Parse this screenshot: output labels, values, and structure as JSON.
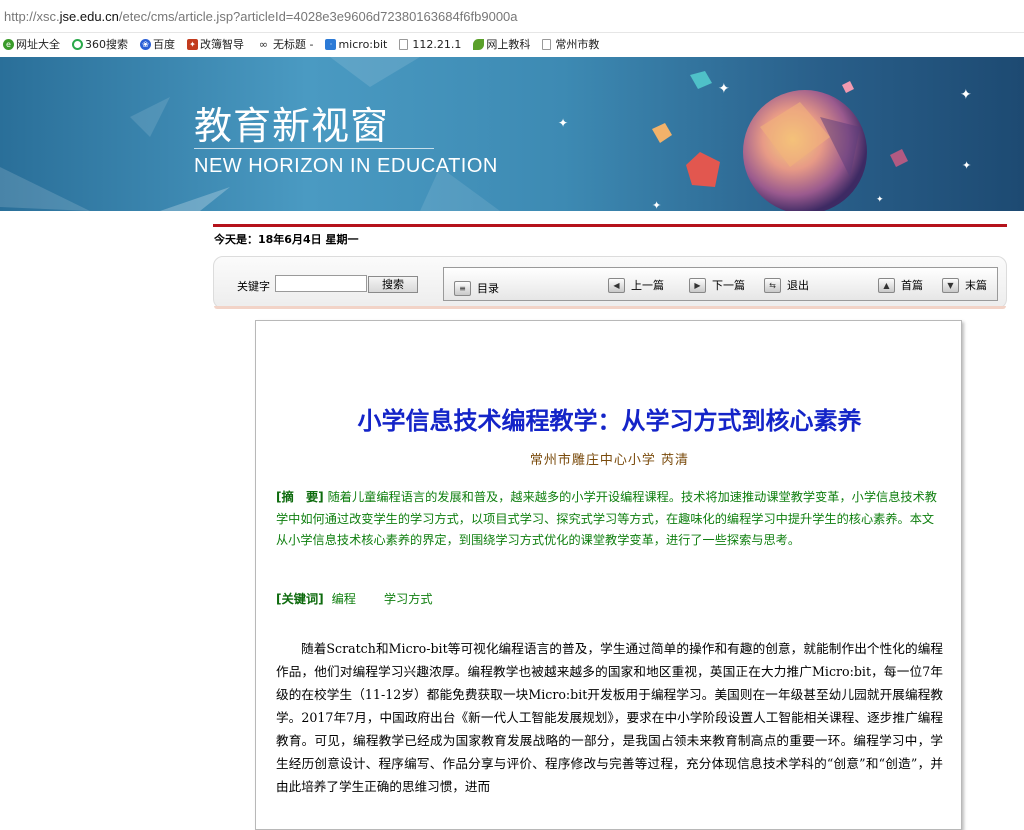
{
  "browser": {
    "url_prefix": "http://xsc.",
    "url_domain": "jse.edu.cn",
    "url_suffix": "/etec/cms/article.jsp?articleId=4028e3e9606d72380163684f6fb9000a"
  },
  "bookmarks": [
    {
      "label": "网址大全",
      "icon": "globe-icon",
      "color": "#3a9b2a"
    },
    {
      "label": "360搜索",
      "icon": "circle-icon",
      "color": "#2aa84a"
    },
    {
      "label": "百度",
      "icon": "paw-icon",
      "color": "#2b5fd6"
    },
    {
      "label": "改簿智导",
      "icon": "bookmark-icon",
      "color": "#c23b1e"
    },
    {
      "label": "无标题 -",
      "icon": "infinity-icon",
      "color": "#333333"
    },
    {
      "label": "micro:bit",
      "icon": "microbit-icon",
      "color": "#2c7ad6"
    },
    {
      "label": "112.21.1",
      "icon": "page-icon",
      "color": "#999999"
    },
    {
      "label": "网上教科",
      "icon": "leaf-icon",
      "color": "#5aa02a"
    },
    {
      "label": "常州市教",
      "icon": "page-icon",
      "color": "#999999"
    }
  ],
  "banner": {
    "title": "教育新视窗",
    "subtitle": "NEW HORIZON IN EDUCATION"
  },
  "date_line": "今天是：18年6月4日  星期一",
  "toolbar": {
    "keyword_label": "关键字",
    "keyword_value": "",
    "search_label": "搜索",
    "nav": {
      "catalog": "目录",
      "prev": "上一篇",
      "next": "下一篇",
      "exit": "退出",
      "first": "首篇",
      "last": "末篇"
    }
  },
  "article": {
    "title": "小学信息技术编程教学：从学习方式到核心素养",
    "author": "常州市雕庄中心小学  芮清",
    "abstract_label": "[摘　要]",
    "abstract_text": "随着儿童编程语言的发展和普及，越来越多的小学开设编程课程。技术将加速推动课堂教学变革，小学信息技术教学中如何通过改变学生的学习方式，以项目式学习、探究式学习等方式，在趣味化的编程学习中提升学生的核心素养。本文从小学信息技术核心素养的界定，到围绕学习方式优化的课堂教学变革，进行了一些探索与思考。",
    "keywords_label": "[关键词]",
    "keywords": [
      "编程",
      "学习方式"
    ],
    "body": "随着Scratch和Micro-bit等可视化编程语言的普及，学生通过简单的操作和有趣的创意，就能制作出个性化的编程作品，他们对编程学习兴趣浓厚。编程教学也被越来越多的国家和地区重视，英国正在大力推广Micro:bit，每一位7年级的在校学生（11-12岁）都能免费获取一块Micro:bit开发板用于编程学习。美国则在一年级甚至幼儿园就开展编程教学。2017年7月，中国政府出台《新一代人工智能发展规划》，要求在中小学阶段设置人工智能相关课程、逐步推广编程教育。可见，编程教学已经成为国家教育发展战略的一部分，是我国占领未来教育制高点的重要一环。编程学习中，学生经历创意设计、程序编写、作品分享与评价、程序修改与完善等过程，充分体现信息技术学科的“创意”和“创造”，并由此培养了学生正确的思维习惯，进而"
  }
}
